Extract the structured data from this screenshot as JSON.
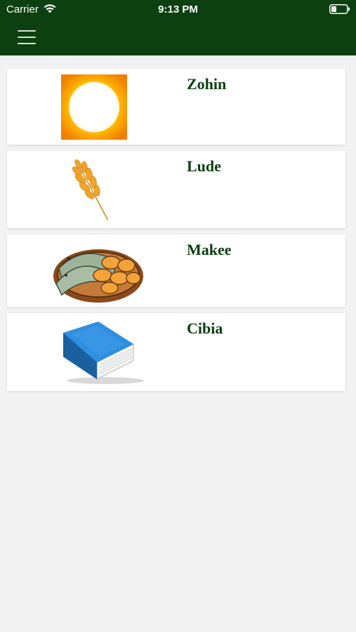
{
  "status_bar": {
    "carrier": "Carrier",
    "time": "9:13 PM",
    "wifi_icon": "wifi-icon",
    "battery_icon": "battery-icon"
  },
  "nav": {
    "menu_icon": "hamburger-menu-icon"
  },
  "colors": {
    "header_green": "#0c4010",
    "word_green": "#0c4010",
    "background": "#f2f2f2"
  },
  "items": [
    {
      "word": "Zohin",
      "picture": "sun-image"
    },
    {
      "word": "Lude",
      "picture": "wheat-image"
    },
    {
      "word": "Makee",
      "picture": "fish-and-bread-basket-image"
    },
    {
      "word": "Cibia",
      "picture": "blue-book-image"
    }
  ]
}
